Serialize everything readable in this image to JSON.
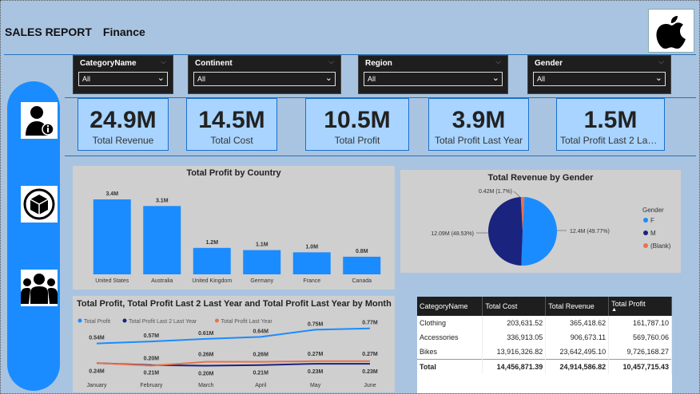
{
  "header": {
    "title": "SALES REPORT",
    "subtitle": "Finance"
  },
  "slicers": [
    {
      "label": "CategoryName",
      "value": "All"
    },
    {
      "label": "Continent",
      "value": "All"
    },
    {
      "label": "Region",
      "value": "All"
    },
    {
      "label": "Gender",
      "value": "All"
    }
  ],
  "kpis": [
    {
      "value": "24.9M",
      "caption": "Total Revenue"
    },
    {
      "value": "14.5M",
      "caption": "Total Cost"
    },
    {
      "value": "10.5M",
      "caption": "Total Profit"
    },
    {
      "value": "3.9M",
      "caption": "Total Profit Last Year"
    },
    {
      "value": "1.5M",
      "caption": "Total Profit Last 2 Last ..."
    }
  ],
  "sidebar": {
    "icons": [
      "user-info-icon",
      "box-icon",
      "group-icon"
    ]
  },
  "colors": {
    "accent": "#1a8cff",
    "navy": "#1a237e",
    "orange": "#e8734a",
    "bar": "#1a8cff"
  },
  "chart_data": [
    {
      "type": "bar",
      "title": "Total Profit by Country",
      "categories": [
        "United States",
        "Australia",
        "United Kingdom",
        "Germany",
        "France",
        "Canada"
      ],
      "values": [
        3.4,
        3.1,
        1.2,
        1.1,
        1.0,
        0.8
      ],
      "labels": [
        "3.4M",
        "3.1M",
        "1.2M",
        "1.1M",
        "1.0M",
        "0.8M"
      ],
      "ylim": [
        0,
        3.4
      ]
    },
    {
      "type": "pie",
      "title": "Total Revenue by Gender",
      "legend_title": "Gender",
      "slices": [
        {
          "name": "F",
          "value": 12.4,
          "label": "12.4M (49.77%)",
          "color": "#1a8cff"
        },
        {
          "name": "M",
          "value": 12.09,
          "label": "12.09M (48.53%)",
          "color": "#1a237e"
        },
        {
          "name": "(Blank)",
          "value": 0.42,
          "label": "0.42M (1.7%)",
          "color": "#e8734a"
        }
      ]
    },
    {
      "type": "line",
      "title": "Total Profit, Total Profit Last 2 Last Year and Total Profit Last Year by Month",
      "categories": [
        "January",
        "February",
        "March",
        "April",
        "May",
        "June"
      ],
      "series": [
        {
          "name": "Total Profit",
          "color": "#1a8cff",
          "values": [
            0.54,
            0.57,
            0.61,
            0.64,
            0.75,
            0.77
          ],
          "labels": [
            "0.54M",
            "0.57M",
            "0.61M",
            "0.64M",
            "0.75M",
            "0.77M"
          ]
        },
        {
          "name": "Total Profit Last 2 Last Year",
          "color": "#1a237e",
          "values": [
            0.24,
            0.21,
            0.2,
            0.21,
            0.23,
            0.23
          ],
          "labels": [
            "0.24M",
            "0.21M",
            "0.20M",
            "0.21M",
            "0.23M",
            "0.23M"
          ]
        },
        {
          "name": "Total Profit Last Year",
          "color": "#e8734a",
          "values": [
            0.24,
            0.2,
            0.26,
            0.26,
            0.27,
            0.27
          ],
          "labels": [
            "",
            "0.20M",
            "0.26M",
            "0.26M",
            "0.27M",
            "0.27M"
          ]
        }
      ]
    },
    {
      "type": "table",
      "columns": [
        "CategoryName",
        "Total Cost",
        "Total Revenue",
        "Total Profit"
      ],
      "rows": [
        [
          "Clothing",
          "203,631.52",
          "365,418.62",
          "161,787.10"
        ],
        [
          "Accessories",
          "336,913.05",
          "906,673.11",
          "569,760.06"
        ],
        [
          "Bikes",
          "13,916,326.82",
          "23,642,495.10",
          "9,726,168.27"
        ]
      ],
      "total": [
        "Total",
        "14,456,871.39",
        "24,914,586.82",
        "10,457,715.43"
      ]
    }
  ]
}
